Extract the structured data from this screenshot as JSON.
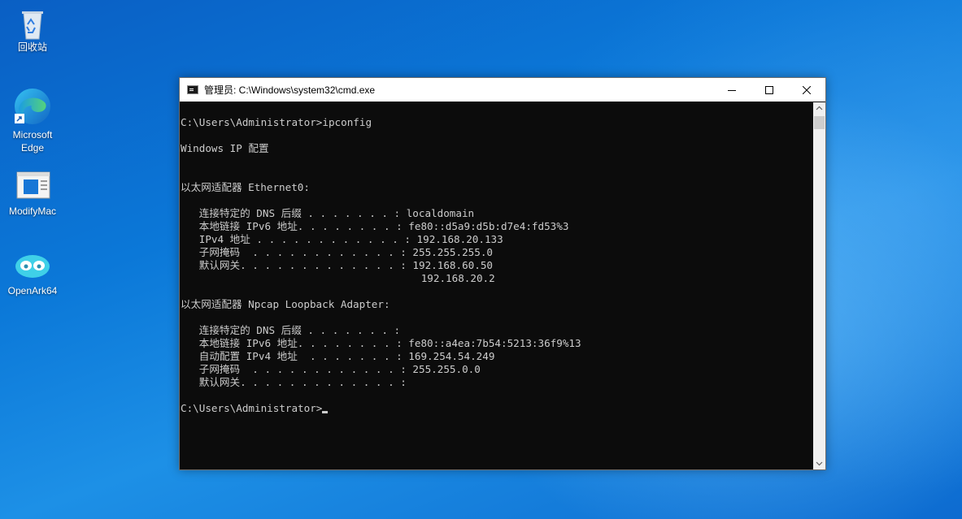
{
  "desktop": {
    "icons": [
      {
        "label": "回收站",
        "icon": "recycle-bin-icon"
      },
      {
        "label": "Microsoft Edge",
        "icon": "edge-icon"
      },
      {
        "label": "ModifyMac",
        "icon": "app-window-icon"
      },
      {
        "label": "OpenArk64",
        "icon": "openark-icon"
      }
    ]
  },
  "window": {
    "title": "管理员: C:\\Windows\\system32\\cmd.exe",
    "minimize_glyph": "—",
    "console_lines": [
      "C:\\Users\\Administrator>ipconfig",
      "",
      "Windows IP 配置",
      "",
      "",
      "以太网适配器 Ethernet0:",
      "",
      "   连接特定的 DNS 后缀 . . . . . . . : localdomain",
      "   本地链接 IPv6 地址. . . . . . . . : fe80::d5a9:d5b:d7e4:fd53%3",
      "   IPv4 地址 . . . . . . . . . . . . : 192.168.20.133",
      "   子网掩码  . . . . . . . . . . . . : 255.255.255.0",
      "   默认网关. . . . . . . . . . . . . : 192.168.60.50",
      "                                       192.168.20.2",
      "",
      "以太网适配器 Npcap Loopback Adapter:",
      "",
      "   连接特定的 DNS 后缀 . . . . . . . :",
      "   本地链接 IPv6 地址. . . . . . . . : fe80::a4ea:7b54:5213:36f9%13",
      "   自动配置 IPv4 地址  . . . . . . . : 169.254.54.249",
      "   子网掩码  . . . . . . . . . . . . : 255.255.0.0",
      "   默认网关. . . . . . . . . . . . . :",
      "",
      "C:\\Users\\Administrator>"
    ]
  },
  "colors": {
    "console_bg": "#0c0c0c",
    "console_fg": "#cccccc",
    "desktop_accent": "#0b78d8"
  }
}
